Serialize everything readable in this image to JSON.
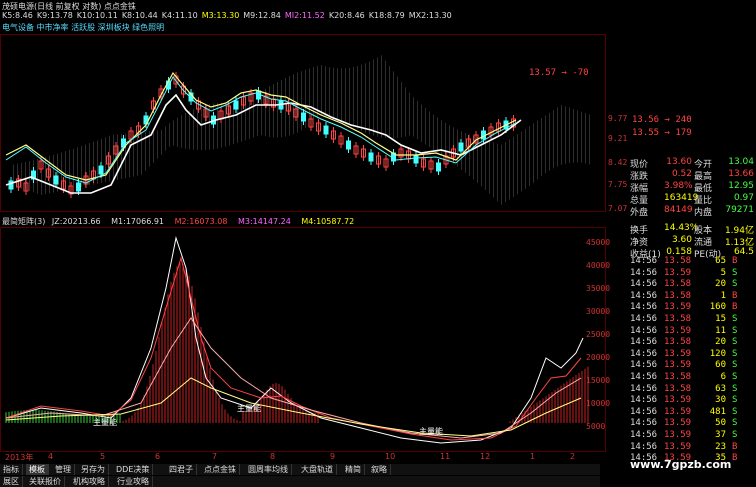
{
  "header": {
    "title": "茂硕电源(日线 前复权 对数) 点点金铢",
    "ma": [
      {
        "label": "K5:",
        "value": "8.46",
        "color": "#dddddd"
      },
      {
        "label": "K9:",
        "value": "13.78",
        "color": "#dddddd"
      },
      {
        "label": "K10:",
        "value": "10.11",
        "color": "#dddddd"
      },
      {
        "label": "K8:",
        "value": "10.44",
        "color": "#dddddd"
      },
      {
        "label": "K4:",
        "value": "11.10",
        "color": "#dddddd"
      },
      {
        "label": "M3:",
        "value": "13.30",
        "color": "#ffff00"
      },
      {
        "label": "M9:",
        "value": "12.84",
        "color": "#dddddd"
      },
      {
        "label": "MI2:",
        "value": "11.52",
        "color": "#ff66ff"
      },
      {
        "label": "K20:",
        "value": "8.46",
        "color": "#dddddd"
      },
      {
        "label": "K18:",
        "value": "8.79",
        "color": "#dddddd"
      },
      {
        "label": "MX2:",
        "value": "13.30",
        "color": "#dddddd"
      }
    ],
    "sectors": "电气设备 中市净率 活跃股 深圳板块 绿色照明"
  },
  "price_axis": {
    "labels": [
      "9.77",
      "9.21",
      "8.42",
      "7.75",
      "7.07"
    ],
    "annotation": "13.57",
    "annotation2": "-70"
  },
  "bid_ask": [
    {
      "price": "13.56",
      "arrow": "→",
      "vol": "240"
    },
    {
      "price": "13.55",
      "arrow": "→",
      "vol": "179"
    }
  ],
  "indicator": {
    "name": "最简矩阵(3)",
    "jz_label": "JZ:",
    "jz_value": "20213.66",
    "m1_label": "M1:",
    "m1_value": "17066.91",
    "m2_label": "M2:",
    "m2_value": "16073.08",
    "m3_label": "M3:",
    "m3_value": "14147.24",
    "m4_label": "M4:",
    "m4_value": "10587.72",
    "axis": [
      "45000",
      "40000",
      "35000",
      "30000",
      "25000",
      "20000",
      "15000",
      "10000",
      "5000"
    ],
    "labels": [
      "主量能",
      "主量能",
      "主量能"
    ]
  },
  "x_axis": {
    "labels": [
      "2013年",
      "4",
      "5",
      "6",
      "7",
      "8",
      "9",
      "10",
      "11",
      "12",
      "1",
      "2"
    ]
  },
  "quote": {
    "rows": [
      {
        "l1": "现价",
        "v1": "13.60",
        "c1": "#ff4444",
        "l2": "今开",
        "v2": "13.04",
        "c2": "#44ff44"
      },
      {
        "l1": "涨跌",
        "v1": "0.52",
        "c1": "#ff4444",
        "l2": "最高",
        "v2": "13.66",
        "c2": "#ff4444"
      },
      {
        "l1": "涨幅",
        "v1": "3.98%",
        "c1": "#ff4444",
        "l2": "最低",
        "v2": "12.95",
        "c2": "#44ff44"
      },
      {
        "l1": "总量",
        "v1": "163419",
        "c1": "#ffff00",
        "l2": "量比",
        "v2": "0.97",
        "c2": "#44ff44"
      },
      {
        "l1": "外盘",
        "v1": "84149",
        "c1": "#ff4444",
        "l2": "内盘",
        "v2": "79271",
        "c2": "#44ff44"
      },
      {
        "l1": "换手",
        "v1": "14.43%",
        "c1": "#ffff00",
        "l2": "股本",
        "v2": "1.94亿",
        "c2": "#ffff00"
      },
      {
        "l1": "净资",
        "v1": "3.60",
        "c1": "#ffff00",
        "l2": "流通",
        "v2": "1.13亿",
        "c2": "#ffff00"
      },
      {
        "l1": "收益(1)",
        "v1": "0.158",
        "c1": "#ffff00",
        "l2": "PE(动)",
        "v2": "64.5",
        "c2": "#ffff00"
      }
    ]
  },
  "ticks": [
    {
      "t": "14:56",
      "p": "13.58",
      "v": "65",
      "d": "B"
    },
    {
      "t": "14:56",
      "p": "13.59",
      "v": "5",
      "d": "S"
    },
    {
      "t": "14:56",
      "p": "13.58",
      "v": "20",
      "d": "S"
    },
    {
      "t": "14:56",
      "p": "13.58",
      "v": "1",
      "d": "B"
    },
    {
      "t": "14:56",
      "p": "13.59",
      "v": "160",
      "d": "B"
    },
    {
      "t": "14:56",
      "p": "13.58",
      "v": "15",
      "d": "S"
    },
    {
      "t": "14:56",
      "p": "13.59",
      "v": "11",
      "d": "S"
    },
    {
      "t": "14:56",
      "p": "13.58",
      "v": "20",
      "d": "S"
    },
    {
      "t": "14:56",
      "p": "13.59",
      "v": "120",
      "d": "S"
    },
    {
      "t": "14:56",
      "p": "13.59",
      "v": "60",
      "d": "S"
    },
    {
      "t": "14:56",
      "p": "13.58",
      "v": "6",
      "d": "S"
    },
    {
      "t": "14:56",
      "p": "13.58",
      "v": "63",
      "d": "S"
    },
    {
      "t": "14:56",
      "p": "13.59",
      "v": "30",
      "d": "S"
    },
    {
      "t": "14:56",
      "p": "13.59",
      "v": "481",
      "d": "S"
    },
    {
      "t": "14:56",
      "p": "13.59",
      "v": "50",
      "d": "S"
    },
    {
      "t": "14:56",
      "p": "13.59",
      "v": "37",
      "d": "S"
    },
    {
      "t": "14:56",
      "p": "13.59",
      "v": "23",
      "d": "B"
    },
    {
      "t": "14:56",
      "p": "13.59",
      "v": "35",
      "d": "B"
    }
  ],
  "toolbar": {
    "tabs": [
      "指标",
      "模板",
      "管理",
      "另存为",
      "DDE决策",
      "四君子",
      "点点金铢",
      "圆周率均线",
      "大盘轨道",
      "精简",
      "叙略"
    ],
    "tabs2": [
      "展区",
      "关联报价",
      "机构攻略",
      "行业攻略"
    ],
    "watermark": "www.7gpzb.com"
  }
}
